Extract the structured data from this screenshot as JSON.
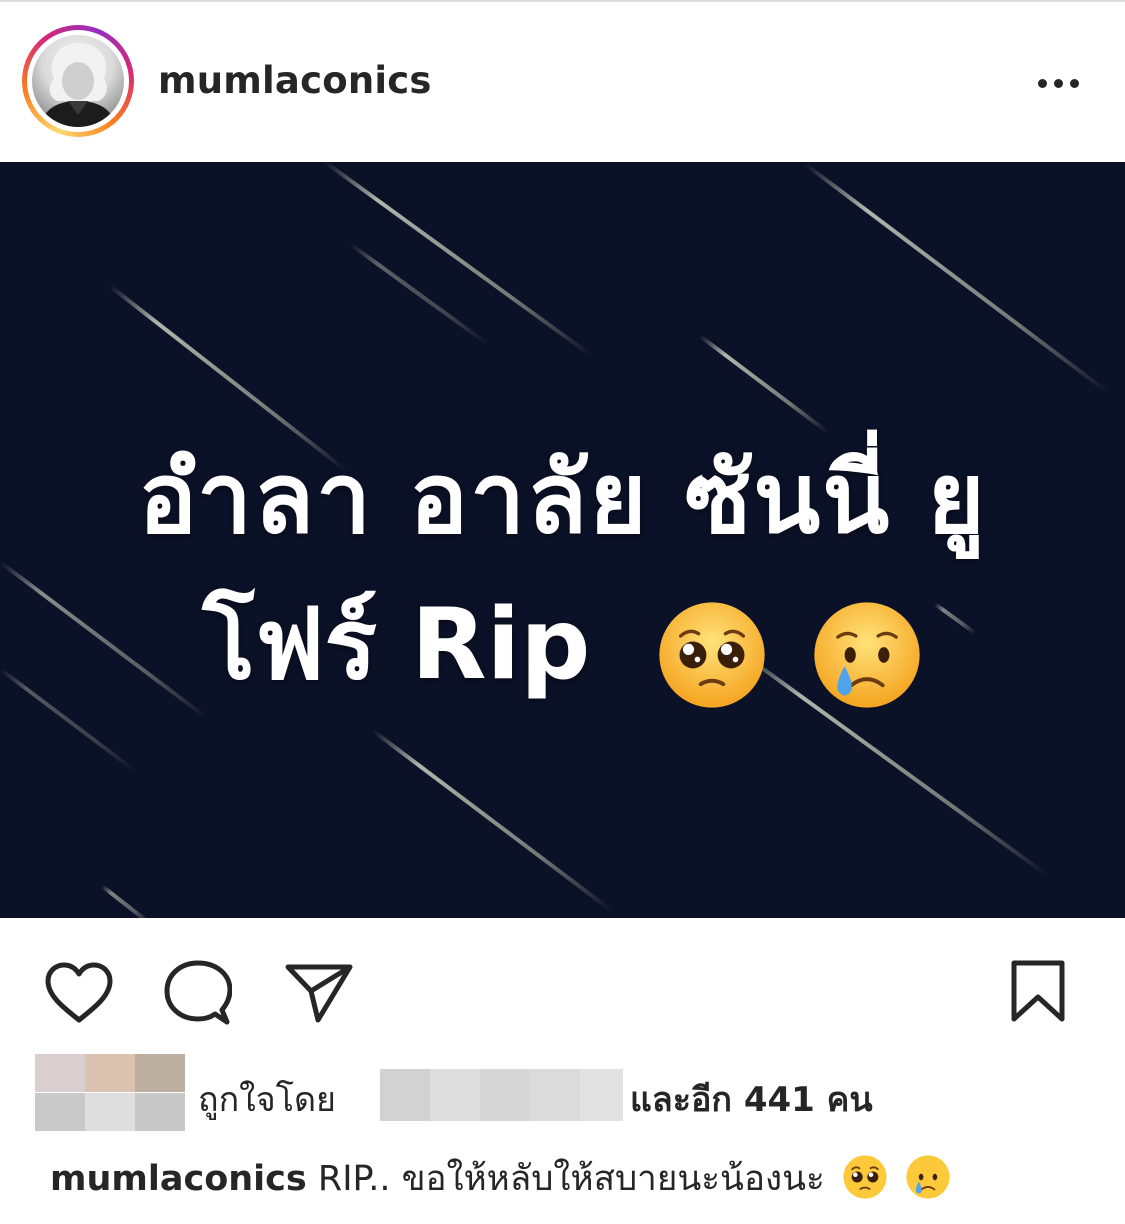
{
  "post": {
    "username": "mumlaconics",
    "more_icon": "more-horizontal-icon",
    "image": {
      "line1": "อำลา อาลัย ซันนี่ ยู",
      "line2": "โฟร์ Rip",
      "emojis": [
        "pleading-face",
        "crying-face"
      ],
      "background_color": "#0b1127"
    },
    "actions": {
      "like_icon": "heart-icon",
      "comment_icon": "comment-icon",
      "share_icon": "send-icon",
      "save_icon": "bookmark-icon"
    },
    "likes": {
      "liked_by_label": "ถูกใจโดย",
      "and_others": "และอีก 441 คน"
    },
    "caption": {
      "username": "mumlaconics",
      "text": "RIP.. ขอให้หลับให้สบายนะน้องนะ",
      "emojis": [
        "pleading-face",
        "crying-face"
      ]
    }
  }
}
